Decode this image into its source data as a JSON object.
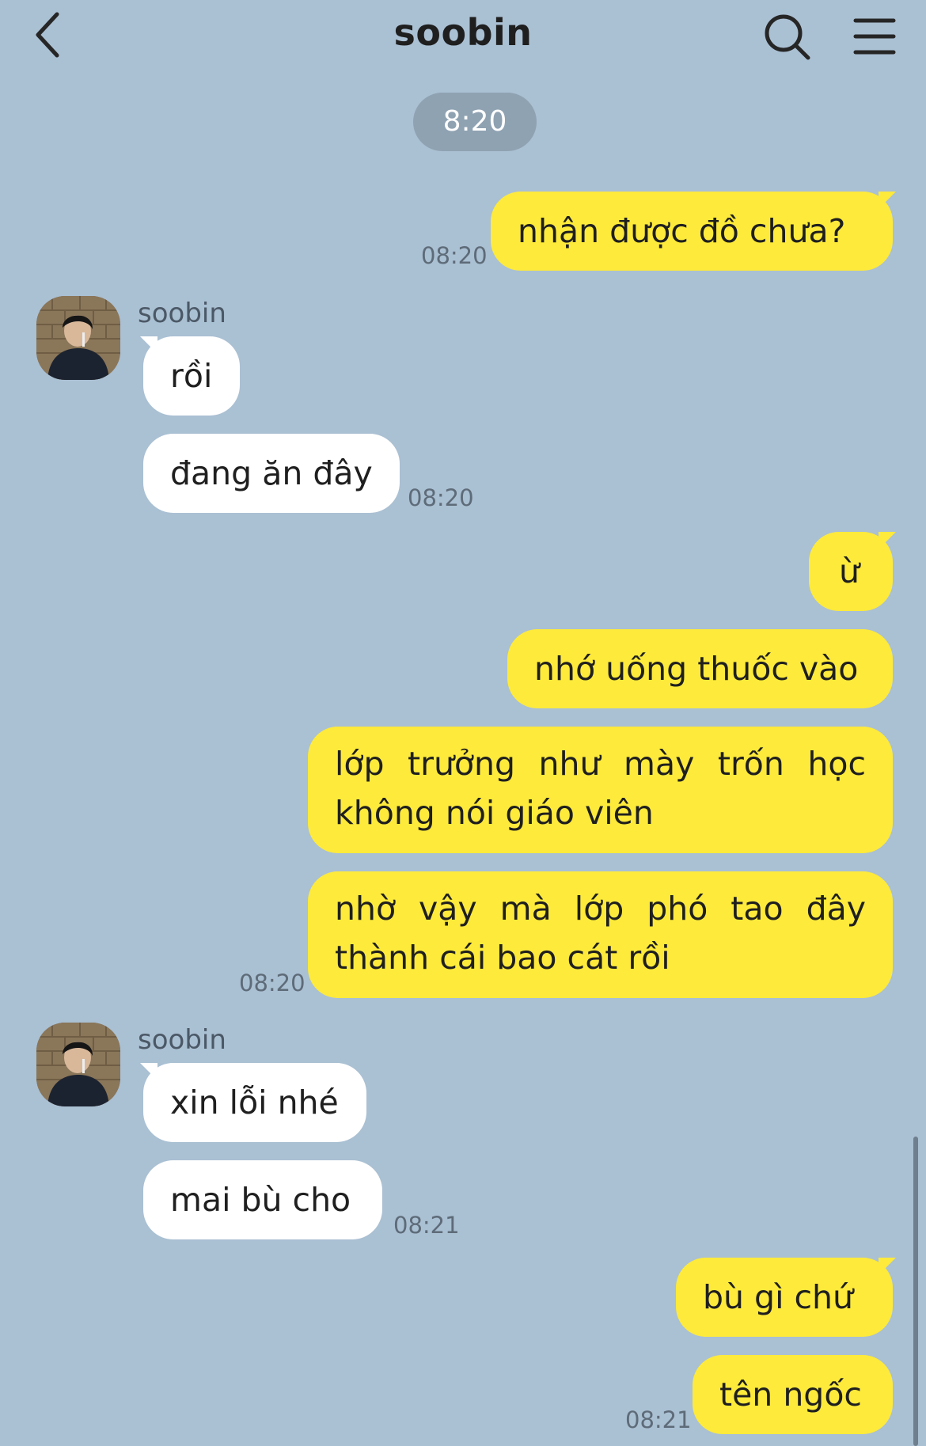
{
  "header": {
    "title": "soobin"
  },
  "date_chip": "8:20",
  "messages": {
    "m1": {
      "text": "nhận được đồ chưa?",
      "time": "08:20"
    },
    "g1_name": "soobin",
    "m2": {
      "text": "rồi"
    },
    "m3": {
      "text": "đang ăn đây",
      "time": "08:20"
    },
    "m4": {
      "text": "ừ"
    },
    "m5": {
      "text": "nhớ uống thuốc vào"
    },
    "m6": {
      "text": "lớp trưởng như mày trốn học không nói giáo viên"
    },
    "m7": {
      "text": "nhờ vậy mà lớp phó tao đây thành cái bao cát rồi",
      "time": "08:20"
    },
    "g2_name": "soobin",
    "m8": {
      "text": "xin lỗi nhé"
    },
    "m9": {
      "text": "mai bù cho",
      "time": "08:21"
    },
    "m10": {
      "text": "bù gì chứ"
    },
    "m11": {
      "text": "tên ngốc",
      "time": "08:21"
    }
  },
  "colors": {
    "background": "#aac0d3",
    "outgoing_bubble": "#fdea3b",
    "incoming_bubble": "#ffffff",
    "date_chip": "#8fa2b2"
  },
  "icons": {
    "back": "chevron-left-icon",
    "search": "search-icon",
    "menu": "hamburger-menu-icon"
  }
}
